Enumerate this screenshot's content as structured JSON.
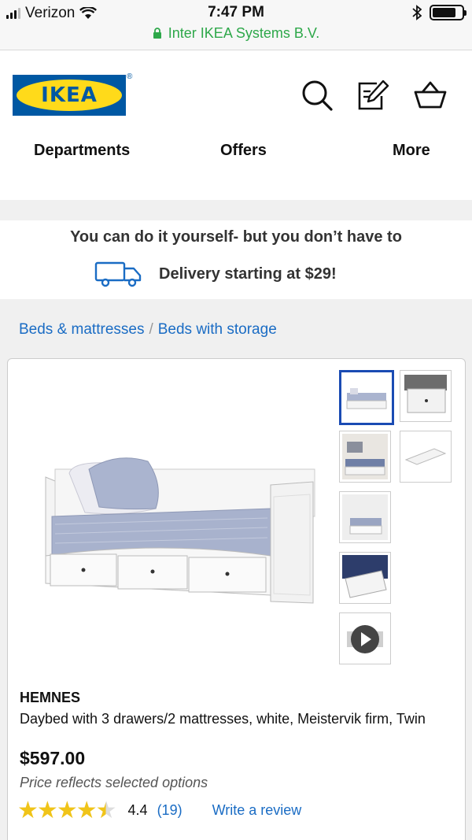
{
  "status_bar": {
    "carrier": "Verizon",
    "time": "7:47 PM",
    "battery_level": 0.8,
    "url_label": "Inter IKEA Systems B.V."
  },
  "header": {
    "logo_text": "IKEA",
    "registered": "®",
    "icons": [
      "search-icon",
      "shopping-list-icon",
      "cart-icon"
    ],
    "nav": [
      "Departments",
      "Offers",
      "More"
    ]
  },
  "banner": {
    "title": "You can do it yourself- but you don’t have to",
    "delivery_text": "Delivery starting at $29!"
  },
  "breadcrumb": {
    "items": [
      "Beds & mattresses",
      "Beds with storage"
    ],
    "separator": "/"
  },
  "product": {
    "brand": "HEMNES",
    "description": "Daybed with 3 drawers/2 mattresses, white, Meistervik firm, Twin",
    "price": "$597.00",
    "price_note": "Price reflects selected options",
    "rating": "4.4",
    "rating_value": 4.4,
    "review_count": "(19)",
    "write_review": "Write a review",
    "thumbnails": [
      "thumb-daybed-front",
      "thumb-drawer-detail",
      "thumb-room-scene",
      "thumb-mattress",
      "thumb-room-scene-2",
      "thumb-drawer-open",
      "thumb-video"
    ]
  },
  "colors": {
    "ikea_blue": "#0058a3",
    "ikea_yellow": "#ffda1a",
    "link": "#1a6cc4",
    "star": "#f0c419",
    "secure": "#2ea84a"
  }
}
